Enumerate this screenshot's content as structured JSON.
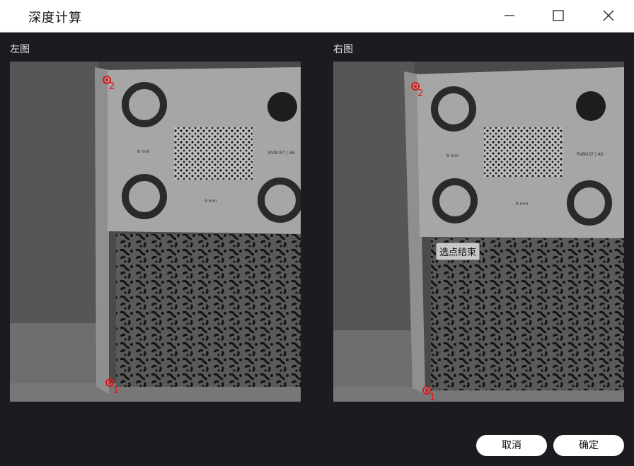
{
  "window": {
    "title": "深度计算"
  },
  "panels": {
    "left": {
      "label": "左图",
      "markers": [
        "2",
        "1"
      ]
    },
    "right": {
      "label": "右图",
      "markers": [
        "2",
        "1"
      ]
    }
  },
  "card_text": {
    "size_label_top": "8 mm",
    "size_label_bottom": "9 mm",
    "brand": "RVBUST | A6"
  },
  "tooltip": "选点结束",
  "buttons": {
    "cancel": "取消",
    "ok": "确定"
  },
  "colors": {
    "marker": "#e01818",
    "background": "#1b1c1f"
  }
}
